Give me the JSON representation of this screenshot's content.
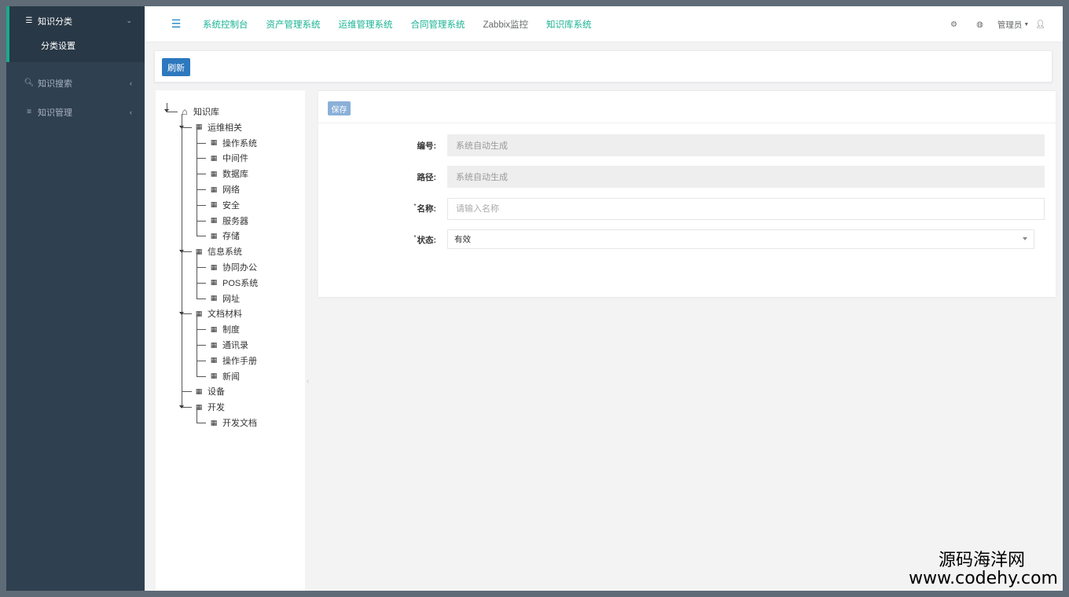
{
  "sidebar": {
    "items": [
      {
        "label": "知识分类",
        "icon": "list-icon",
        "active": true
      },
      {
        "label": "知识搜索",
        "icon": "search-icon"
      },
      {
        "label": "知识管理",
        "icon": "menu-icon"
      }
    ],
    "subitems": [
      {
        "label": "分类设置"
      }
    ]
  },
  "topnav": {
    "links": [
      "系统控制台",
      "资产管理系统",
      "运维管理系统",
      "合同管理系统",
      "Zabbix监控",
      "知识库系统"
    ],
    "user": "管理员"
  },
  "toolbar": {
    "refresh_label": "刷新"
  },
  "tree": {
    "root": "知识库",
    "groups": [
      {
        "label": "运维相关",
        "children": [
          "操作系统",
          "中间件",
          "数据库",
          "网络",
          "安全",
          "服务器",
          "存储"
        ]
      },
      {
        "label": "信息系统",
        "children": [
          "协同办公",
          "POS系统",
          "网址"
        ]
      },
      {
        "label": "文档材料",
        "children": [
          "制度",
          "通讯录",
          "操作手册",
          "新闻"
        ]
      },
      {
        "label": "设备",
        "children": []
      },
      {
        "label": "开发",
        "children": [
          "开发文档"
        ]
      }
    ]
  },
  "form": {
    "save_label": "保存",
    "fields": {
      "code": {
        "label": "编号:",
        "value": "系统自动生成"
      },
      "path": {
        "label": "路径:",
        "value": "系统自动生成"
      },
      "name": {
        "label": "名称:",
        "placeholder": "请输入名称"
      },
      "status": {
        "label": "状态:",
        "value": "有效"
      }
    }
  },
  "watermark": {
    "line1": "源码海洋网",
    "line2": "www.codehy.com"
  },
  "colors": {
    "sidebar": "#2f4050",
    "accent": "#1ab394",
    "primary": "#2d78be"
  }
}
